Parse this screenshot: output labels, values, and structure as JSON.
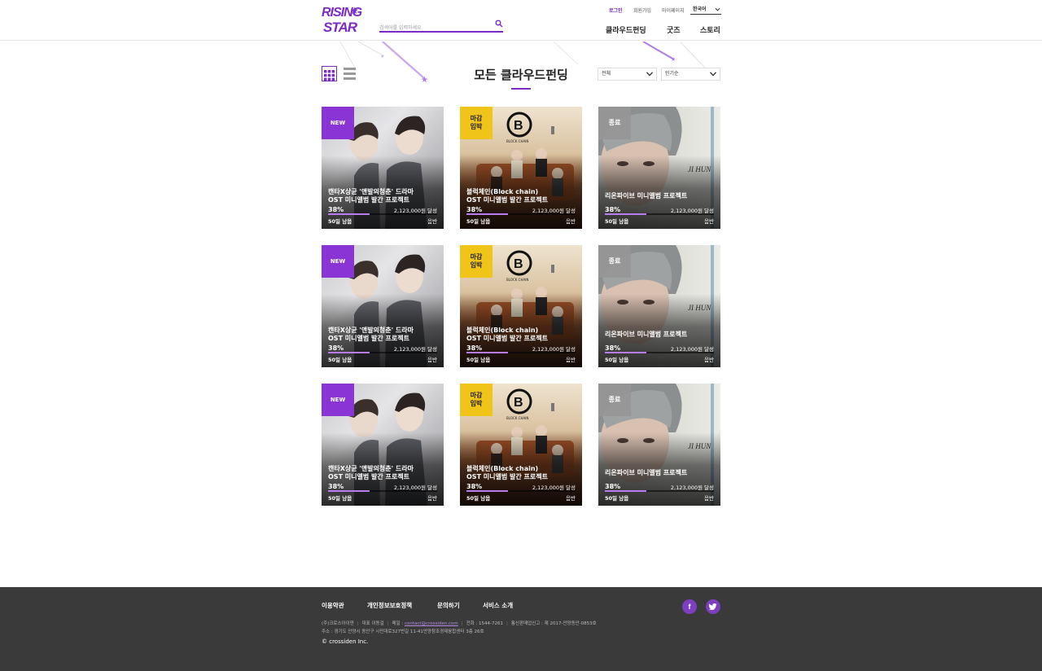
{
  "header": {
    "logo_top": "RISING",
    "logo_bottom": "STAR",
    "search_placeholder": "검색어를 입력하세요",
    "util_links": [
      "로그인",
      "회원가입",
      "마이페이지"
    ],
    "language": "한국어",
    "main_nav": [
      "클라우드펀딩",
      "굿즈",
      "스토리"
    ],
    "active_nav": "굿즈"
  },
  "colors": {
    "accent": "#7b2cc7",
    "new_badge": "#8a34d6",
    "deadline_badge": "#f0c419",
    "ended_badge": "#969696",
    "footer_bg": "#3a3a3a"
  },
  "main": {
    "title": "모든 클라우드펀딩",
    "filter_category": "전체",
    "filter_sort": "인기순",
    "view_icons": [
      "grid-view-icon",
      "list-view-icon"
    ]
  },
  "cards": [
    {
      "badge": "NEW",
      "badge_type": "new",
      "title": "캔타X상균 '앤발의청춘' 드라마\nOST 미니앨범 발간 프로젝트",
      "percent": "38%",
      "progress": 0.38,
      "amount": "2,123,000원 달성",
      "days": "50일 남음",
      "category": "음반",
      "art": "duo"
    },
    {
      "badge": "마감\n임박",
      "badge_type": "hot",
      "title": "블럭체인(Block chain)\nOST 미니앨범 발간 프로젝트",
      "percent": "38%",
      "progress": 0.38,
      "amount": "2,123,000원 달성",
      "days": "50일 남음",
      "category": "음반",
      "art": "band"
    },
    {
      "badge": "종료",
      "badge_type": "end",
      "title": "리온파이브 미니앨범 프로젝트",
      "percent": "38%",
      "progress": 0.38,
      "amount": "2,123,000원 달성",
      "days": "50일 남음",
      "category": "음반",
      "art": "solo"
    },
    {
      "badge": "NEW",
      "badge_type": "new",
      "title": "캔타X상균 '앤발의청춘' 드라마\nOST 미니앨범 발간 프로젝트",
      "percent": "38%",
      "progress": 0.38,
      "amount": "2,123,000원 달성",
      "days": "50일 남음",
      "category": "음반",
      "art": "duo"
    },
    {
      "badge": "마감\n임박",
      "badge_type": "hot",
      "title": "블럭체인(Block chain)\nOST 미니앨범 발간 프로젝트",
      "percent": "38%",
      "progress": 0.38,
      "amount": "2,123,000원 달성",
      "days": "50일 남음",
      "category": "음반",
      "art": "band"
    },
    {
      "badge": "종료",
      "badge_type": "end",
      "title": "리온파이브 미니앨범 프로젝트",
      "percent": "38%",
      "progress": 0.38,
      "amount": "2,123,000원 달성",
      "days": "50일 남음",
      "category": "음반",
      "art": "solo"
    },
    {
      "badge": "NEW",
      "badge_type": "new",
      "title": "캔타X상균 '앤발의청춘' 드라마\nOST 미니앨범 발간 프로젝트",
      "percent": "38%",
      "progress": 0.38,
      "amount": "2,123,000원 달성",
      "days": "50일 남음",
      "category": "음반",
      "art": "duo"
    },
    {
      "badge": "마감\n임박",
      "badge_type": "hot",
      "title": "블럭체인(Block chain)\nOST 미니앨범 발간 프로젝트",
      "percent": "38%",
      "progress": 0.38,
      "amount": "2,123,000원 달성",
      "days": "50일 남음",
      "category": "음반",
      "art": "band"
    },
    {
      "badge": "종료",
      "badge_type": "end",
      "title": "리온파이브 미니앨범 프로젝트",
      "percent": "38%",
      "progress": 0.38,
      "amount": "2,123,000원 달성",
      "days": "50일 남음",
      "category": "음반",
      "art": "solo"
    }
  ],
  "art_text": {
    "band_logo": "BLOCK CHAIN",
    "solo_name": "JI HUN"
  },
  "footer": {
    "links": [
      "이용약관",
      "개인정보보호정책",
      "문의하기",
      "서비스 소개"
    ],
    "company": "(주)크로스아이덴",
    "ceo": "대표 이동걸",
    "email_label": "메일 : ",
    "email": "contact@crossiden.com",
    "phone": "전화 : 1544-7261",
    "license": "통신판매업신고 : 제 2017-안양동안-0853호",
    "address": "주소 : 경기도 안양시 동안구 시민대로327번길 11-41안양창조경제융합센터 3층 26호",
    "copyright": "© crossiden Inc.",
    "social": [
      "facebook-icon",
      "twitter-icon"
    ]
  }
}
